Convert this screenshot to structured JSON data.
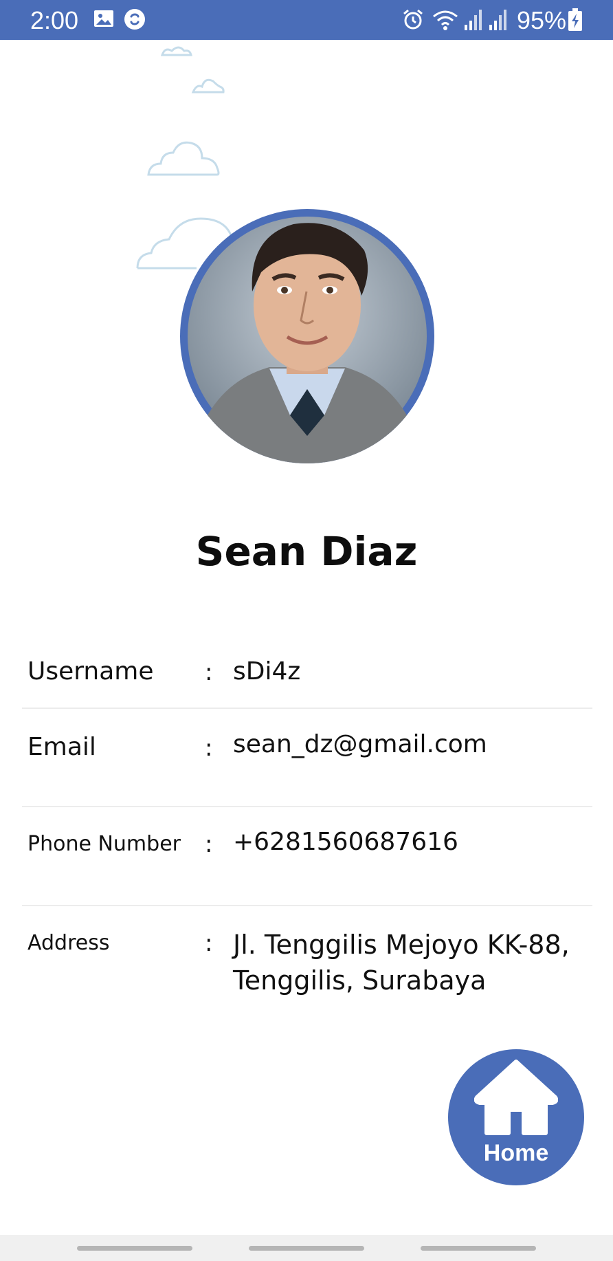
{
  "status_bar": {
    "time": "2:00",
    "battery": "95%",
    "icons": [
      "image-icon",
      "sync-icon",
      "alarm-icon",
      "wifi-icon",
      "signal-icon",
      "signal-icon",
      "battery-charging-icon"
    ]
  },
  "profile": {
    "name": "Sean Diaz",
    "avatar": "profile-photo"
  },
  "info": {
    "username": {
      "label": "Username",
      "value": "sDi4z"
    },
    "email": {
      "label": "Email",
      "value": "sean_dz@gmail.com"
    },
    "phone": {
      "label": "Phone Number",
      "value": "+6281560687616"
    },
    "address": {
      "label": "Address",
      "value_line1": "Jl. Tenggilis Mejoyo KK-88,",
      "value_line2": "Tenggilis, Surabaya"
    },
    "separator": ":"
  },
  "home_button": {
    "label": "Home",
    "icon": "home-icon"
  },
  "colors": {
    "primary": "#4a6db8",
    "cloud": "#c5dcea",
    "text": "#111111",
    "divider": "#ececec"
  }
}
